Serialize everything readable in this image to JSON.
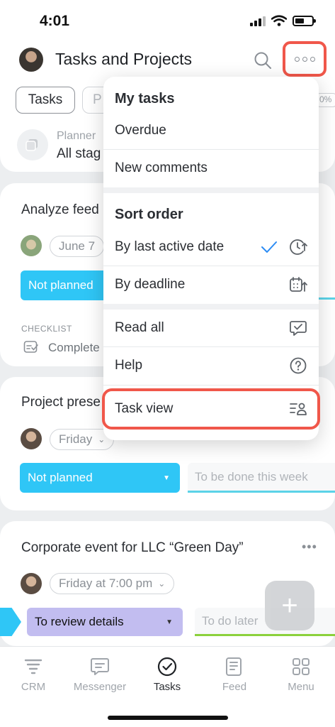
{
  "status_bar": {
    "time": "4:01"
  },
  "header": {
    "title": "Tasks and Projects",
    "filters": {
      "tasks_chip": "Tasks",
      "second_chip_partial": "P",
      "percent_partial": "0%"
    },
    "planner": {
      "label": "Planner",
      "value": "All stag"
    }
  },
  "tasks": [
    {
      "title": "Analyze feed",
      "date": "June 7",
      "stage": "Not planned",
      "checklist_label": "CHECKLIST",
      "checklist_status": "Complete"
    },
    {
      "title": "Project prese",
      "date": "Friday",
      "stage": "Not planned",
      "next_stage": "To be done this week"
    },
    {
      "title": "Corporate event for LLC “Green Day”",
      "date": "Friday at 7:00 pm",
      "stage": "To review details",
      "next_stage": "To do later"
    }
  ],
  "menu": {
    "my_tasks_heading": "My tasks",
    "overdue": "Overdue",
    "new_comments": "New comments",
    "sort_heading": "Sort order",
    "by_last_active": "By last active date",
    "by_deadline": "By deadline",
    "read_all": "Read all",
    "help": "Help",
    "task_view": "Task view"
  },
  "fab_symbol": "+",
  "bottom_nav": [
    {
      "label": "CRM",
      "icon": "crm-icon"
    },
    {
      "label": "Messenger",
      "icon": "messenger-icon"
    },
    {
      "label": "Tasks",
      "icon": "tasks-icon",
      "active": true
    },
    {
      "label": "Feed",
      "icon": "feed-icon"
    },
    {
      "label": "Menu",
      "icon": "menu-grid-icon"
    }
  ],
  "colors": {
    "accent_blue": "#2fc6f6",
    "stage_purple": "#c2bdf0",
    "highlight_red": "#f0574a",
    "check_blue": "#2c8cf4",
    "progress_teal": "#5bd3e8",
    "progress_green": "#8bd13c"
  }
}
